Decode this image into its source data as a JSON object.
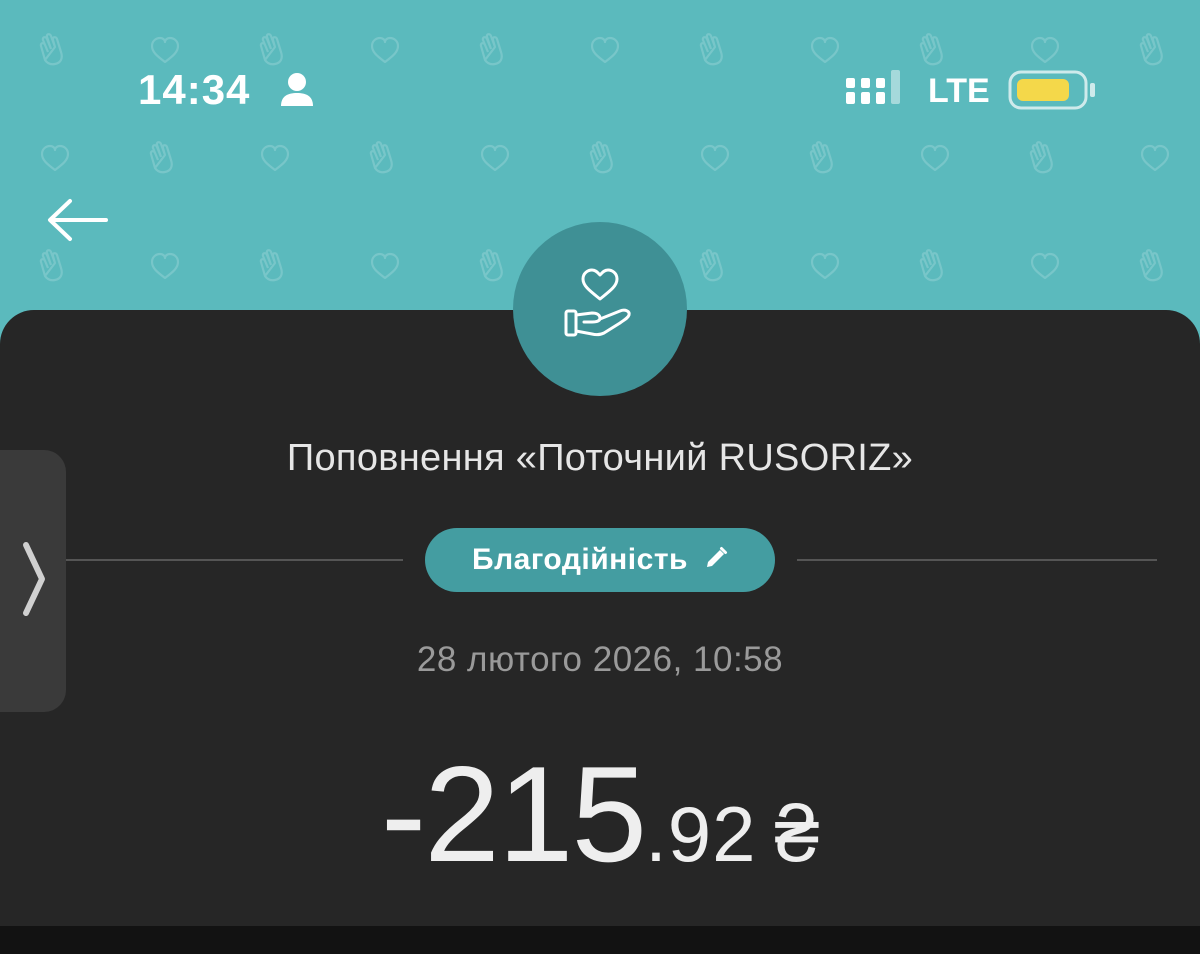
{
  "status_bar": {
    "time": "14:34",
    "network": "LTE",
    "icons": [
      "person-icon",
      "signal-icon",
      "battery-icon"
    ],
    "battery_color": "#f4d84a"
  },
  "header": {
    "background_color": "#5bbabd",
    "pattern_icons": [
      "heart-outline-icon",
      "waving-hand-icon"
    ],
    "back_icon": "arrow-left-icon"
  },
  "transaction": {
    "icon": "heart-in-hand-icon",
    "title": "Поповнення «Поточний RUSORIZ»",
    "category": "Благодійність",
    "category_icon": "pencil-icon",
    "category_color": "#449da1",
    "datetime": "28 лютого 2026, 10:58",
    "amount_integer": "-215",
    "amount_fraction": ".92",
    "currency": "₴"
  },
  "side_tab": {
    "icon": "chevron-right-icon"
  },
  "colors": {
    "card_background": "#262626",
    "avatar_background": "#3f9095"
  }
}
